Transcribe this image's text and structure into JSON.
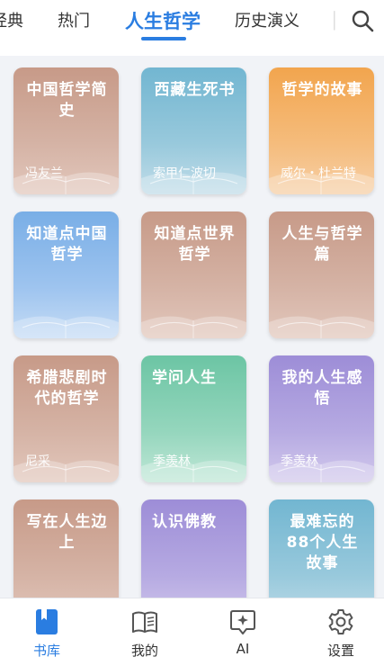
{
  "tabs": [
    {
      "label": "经典"
    },
    {
      "label": "热门"
    },
    {
      "label": "人生哲学"
    },
    {
      "label": "历史演义"
    }
  ],
  "books": [
    {
      "title": "中国哲学简史",
      "author": "冯友兰"
    },
    {
      "title": "西藏生死书",
      "author": "索甲仁波切"
    },
    {
      "title": "哲学的故事",
      "author": "威尔・杜兰特"
    },
    {
      "title": "知道点中国哲学",
      "author": ""
    },
    {
      "title": "知道点世界哲学",
      "author": ""
    },
    {
      "title": "人生与哲学篇",
      "author": ""
    },
    {
      "title": "希腊悲剧时代的哲学",
      "author": "尼采"
    },
    {
      "title": "学问人生",
      "author": "季羡林"
    },
    {
      "title": "我的人生感悟",
      "author": "季羡林"
    },
    {
      "title": "写在人生边上",
      "author": ""
    },
    {
      "title": "认识佛教",
      "author": ""
    },
    {
      "title": "最难忘的88个人生故事",
      "author": ""
    }
  ],
  "nav": [
    {
      "label": "书库",
      "icon": "bookmark-icon"
    },
    {
      "label": "我的",
      "icon": "open-book-icon"
    },
    {
      "label": "AI",
      "icon": "ai-sparkle-icon"
    },
    {
      "label": "设置",
      "icon": "gear-icon"
    }
  ],
  "colors": {
    "accent": "#2a7de1"
  }
}
